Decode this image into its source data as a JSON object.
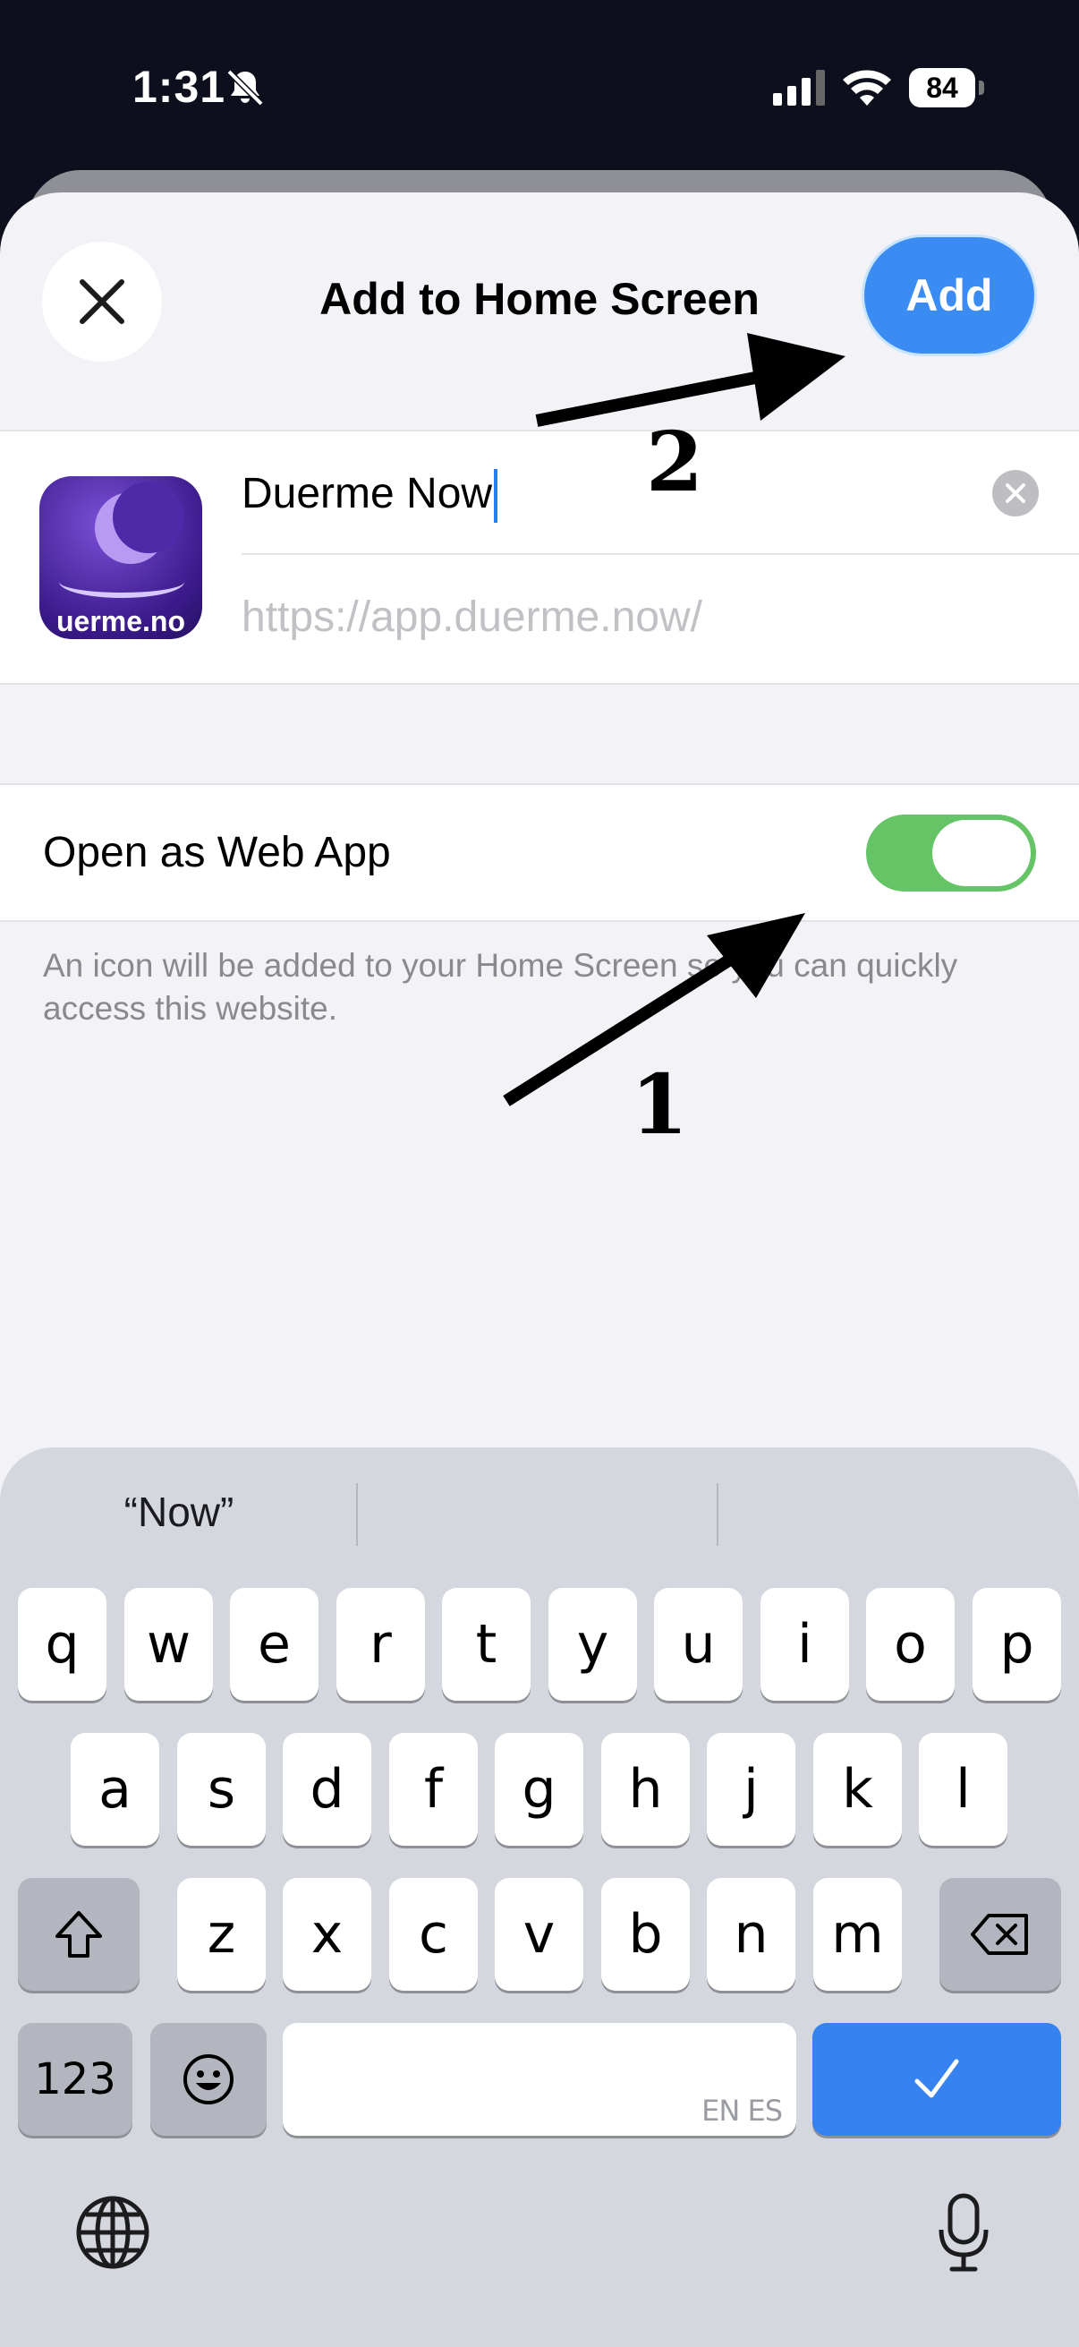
{
  "status_bar": {
    "time": "1:31",
    "battery": "84",
    "icons": [
      "bell-slash-icon",
      "signal-icon",
      "wifi-icon",
      "battery-icon"
    ]
  },
  "sheet": {
    "title": "Add to Home Screen",
    "add_label": "Add",
    "close_icon": "close-icon"
  },
  "bookmark": {
    "icon_label": "uerme.no",
    "name_value": "Duerme Now",
    "url_value": "https://app.duerme.now/"
  },
  "web_app": {
    "label": "Open as Web App",
    "enabled": true,
    "note": "An icon will be added to your Home Screen so you can quickly access this website."
  },
  "annotations": {
    "step1": "1",
    "step2": "2"
  },
  "keyboard": {
    "suggestions": [
      "“Now”",
      "",
      ""
    ],
    "row1": [
      "q",
      "w",
      "e",
      "r",
      "t",
      "y",
      "u",
      "i",
      "o",
      "p"
    ],
    "row2": [
      "a",
      "s",
      "d",
      "f",
      "g",
      "h",
      "j",
      "k",
      "l"
    ],
    "row3": [
      "z",
      "x",
      "c",
      "v",
      "b",
      "n",
      "m"
    ],
    "numbers_key": "123",
    "space_lang": "EN ES",
    "accent_color": "#3582f0"
  }
}
